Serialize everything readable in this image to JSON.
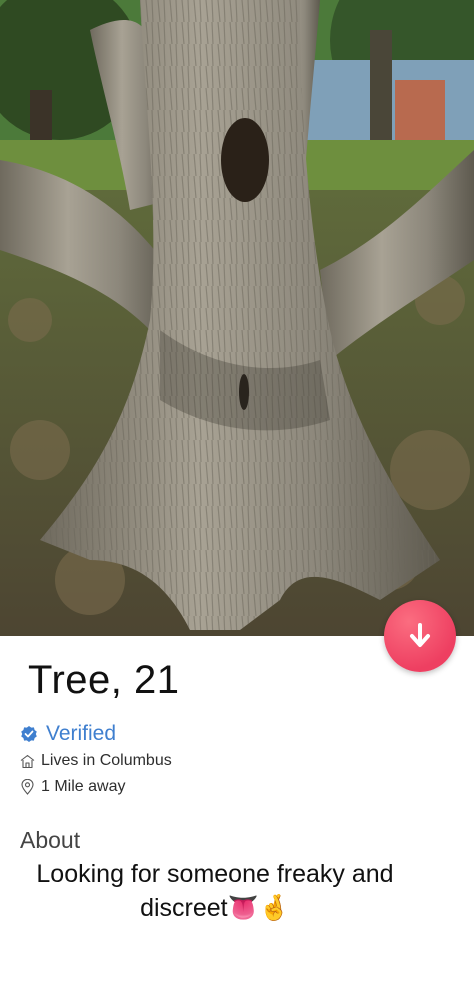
{
  "profile": {
    "name_age": "Tree, 21",
    "verified_label": "Verified",
    "lives_in": "Lives in Columbus",
    "distance": "1 Mile away",
    "about_heading": "About",
    "bio": "Looking for someone freaky and discreet👅🤞"
  },
  "icons": {
    "verified": "verified-badge-icon",
    "home": "home-icon",
    "location": "location-pin-icon",
    "expand": "arrow-down-icon"
  },
  "colors": {
    "accent": "#ee3f61",
    "verified": "#3f7fcf"
  }
}
